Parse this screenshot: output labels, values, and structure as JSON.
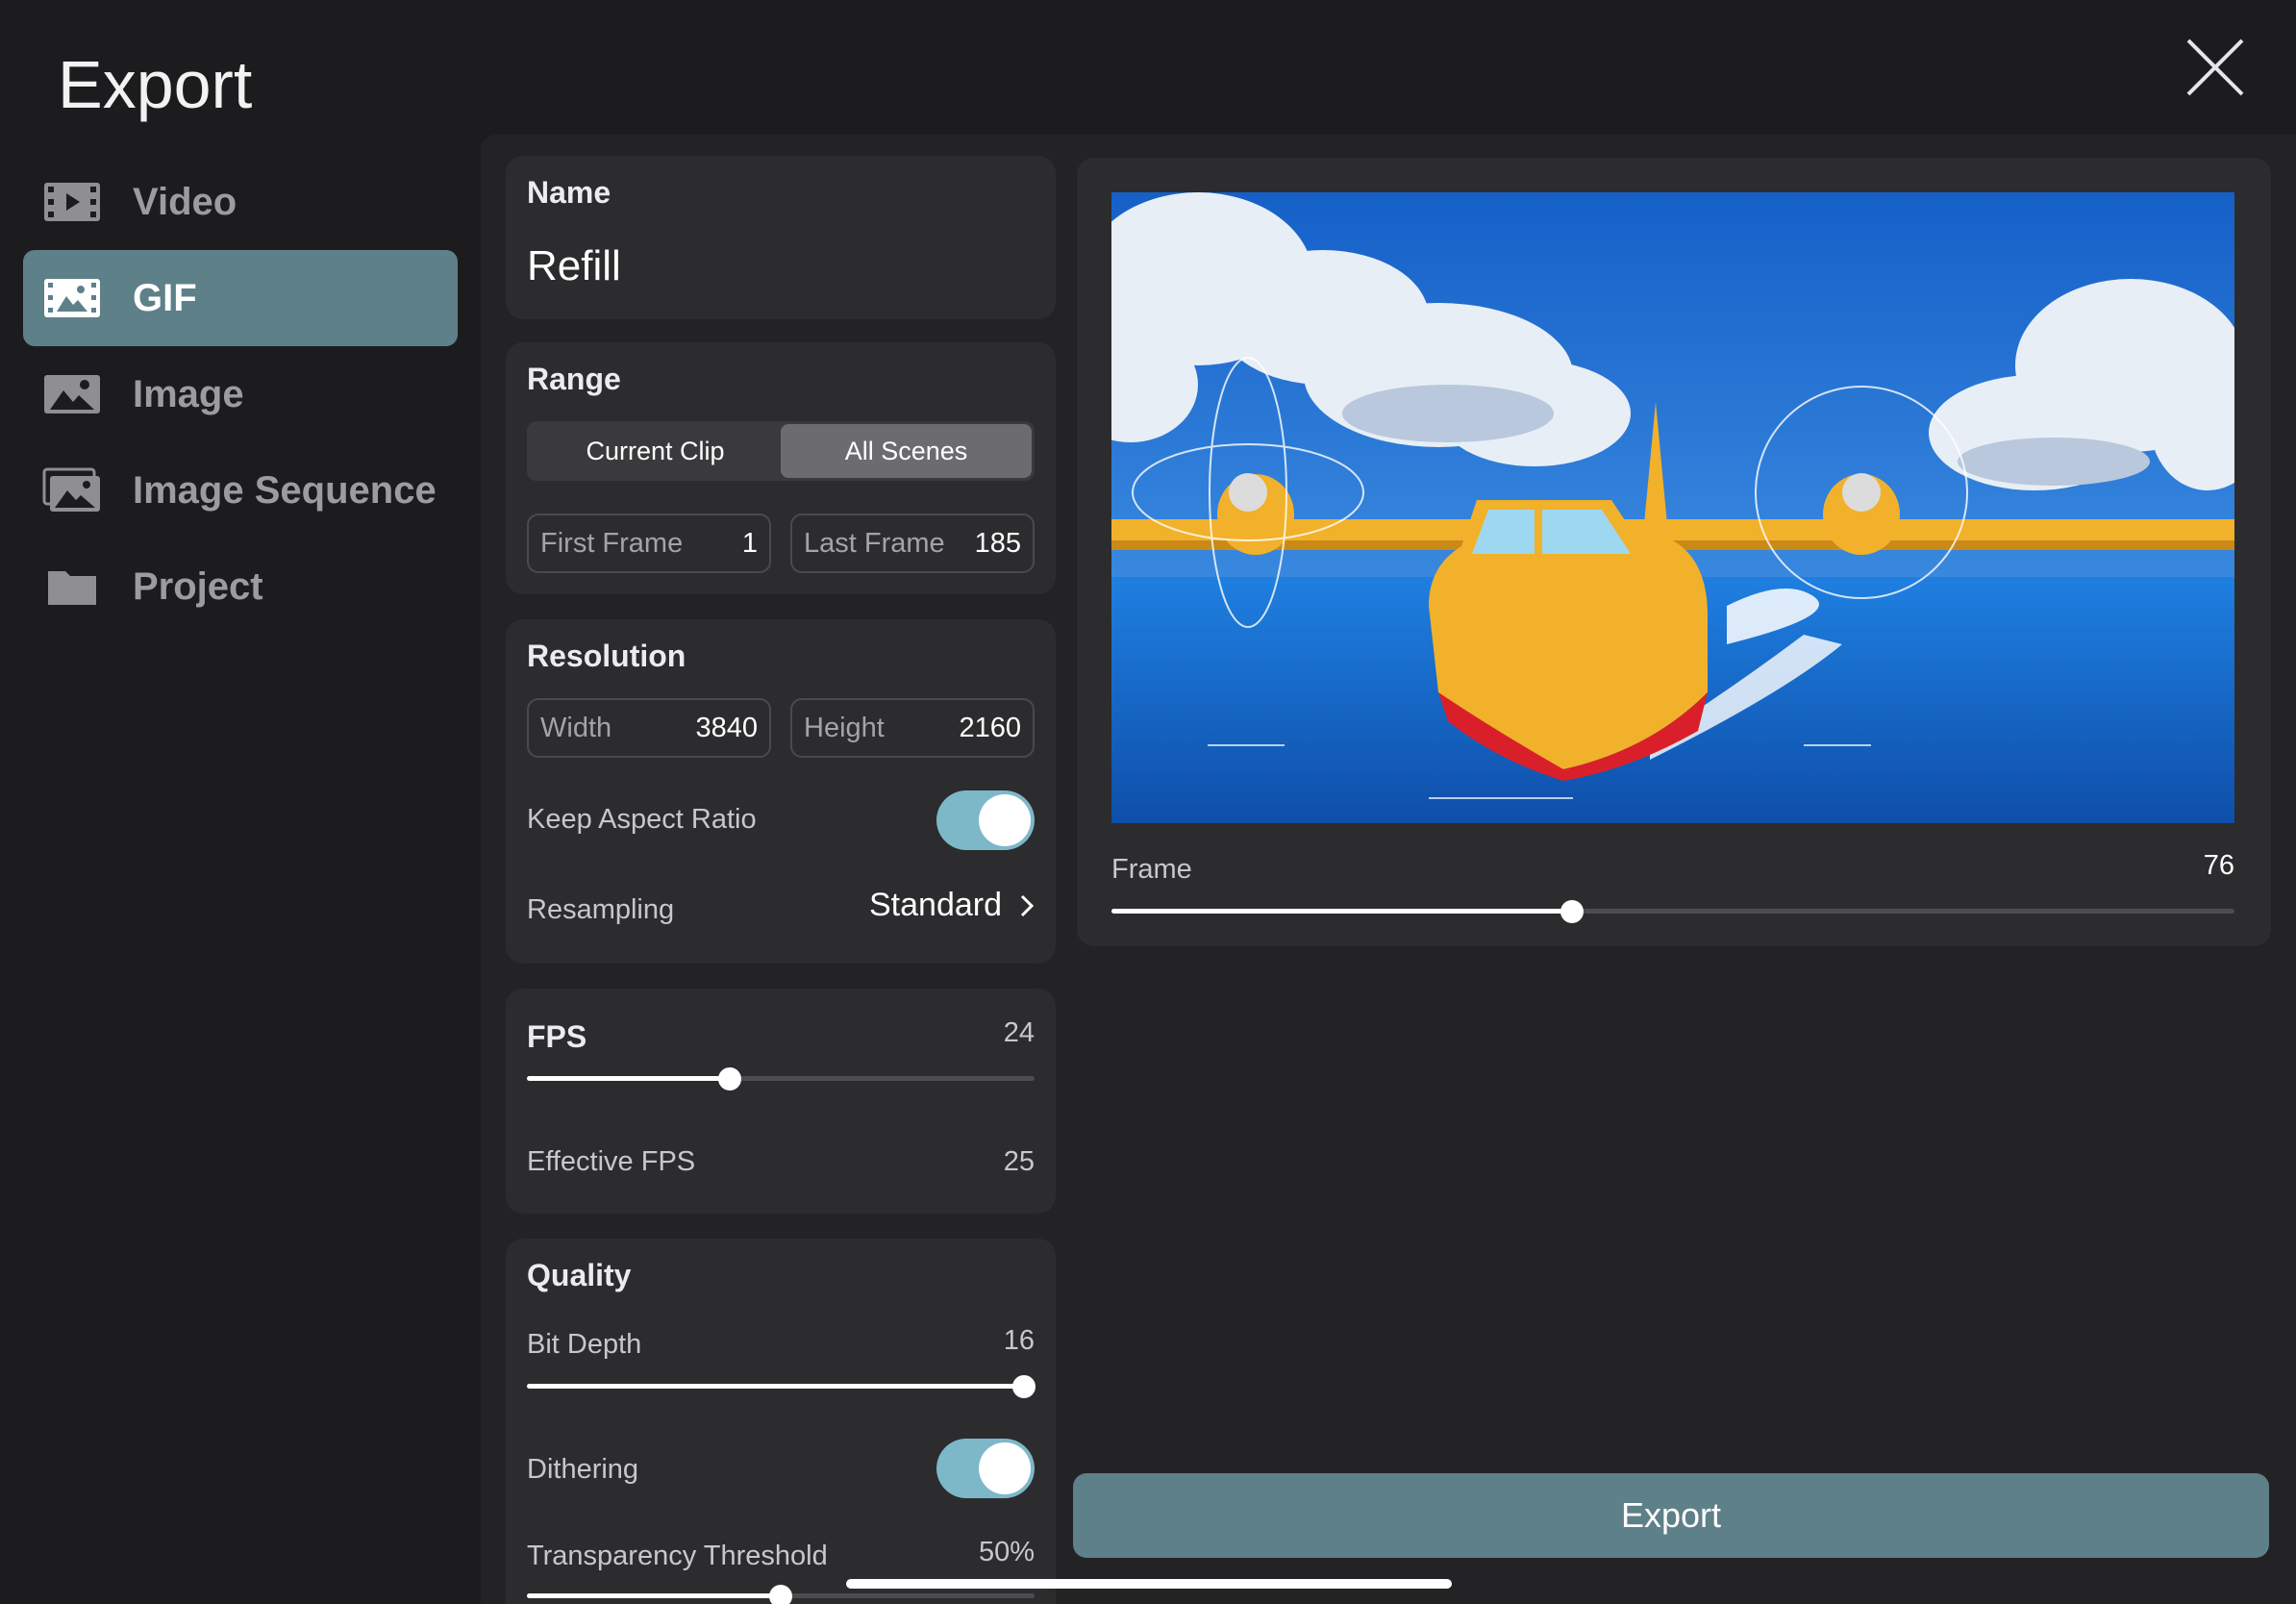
{
  "header": {
    "title": "Export"
  },
  "sidebar": {
    "items": [
      {
        "label": "Video",
        "icon": "film-icon",
        "active": false
      },
      {
        "label": "GIF",
        "icon": "gif-image-icon",
        "active": true
      },
      {
        "label": "Image",
        "icon": "image-icon",
        "active": false
      },
      {
        "label": "Image Sequence",
        "icon": "image-stack-icon",
        "active": false
      },
      {
        "label": "Project",
        "icon": "folder-icon",
        "active": false
      }
    ]
  },
  "name_card": {
    "title": "Name",
    "value": "Refill"
  },
  "range": {
    "title": "Range",
    "segments": [
      "Current Clip",
      "All Scenes"
    ],
    "selected_segment": "All Scenes",
    "first_frame": {
      "label": "First Frame",
      "value": "1"
    },
    "last_frame": {
      "label": "Last Frame",
      "value": "185"
    }
  },
  "resolution": {
    "title": "Resolution",
    "width": {
      "label": "Width",
      "value": "3840"
    },
    "height": {
      "label": "Height",
      "value": "2160"
    },
    "keep_aspect": {
      "label": "Keep Aspect Ratio",
      "on": true
    },
    "resampling": {
      "label": "Resampling",
      "value": "Standard"
    }
  },
  "fps": {
    "title": "FPS",
    "value": "24",
    "slider_fraction": 0.4,
    "effective_label": "Effective FPS",
    "effective_value": "25"
  },
  "quality": {
    "title": "Quality",
    "bit_depth": {
      "label": "Bit Depth",
      "value": "16",
      "slider_fraction": 0.98
    },
    "dithering": {
      "label": "Dithering",
      "on": true
    },
    "transparency": {
      "label": "Transparency Threshold",
      "value": "50%",
      "slider_fraction": 0.5
    }
  },
  "preview": {
    "frame_label": "Frame",
    "frame_value": "76",
    "slider_fraction": 0.41
  },
  "actions": {
    "export_label": "Export"
  },
  "colors": {
    "accent": "#5e8089",
    "toggle_on": "#7db8c9",
    "background": "#1c1c1e",
    "card": "#2c2c2e"
  }
}
